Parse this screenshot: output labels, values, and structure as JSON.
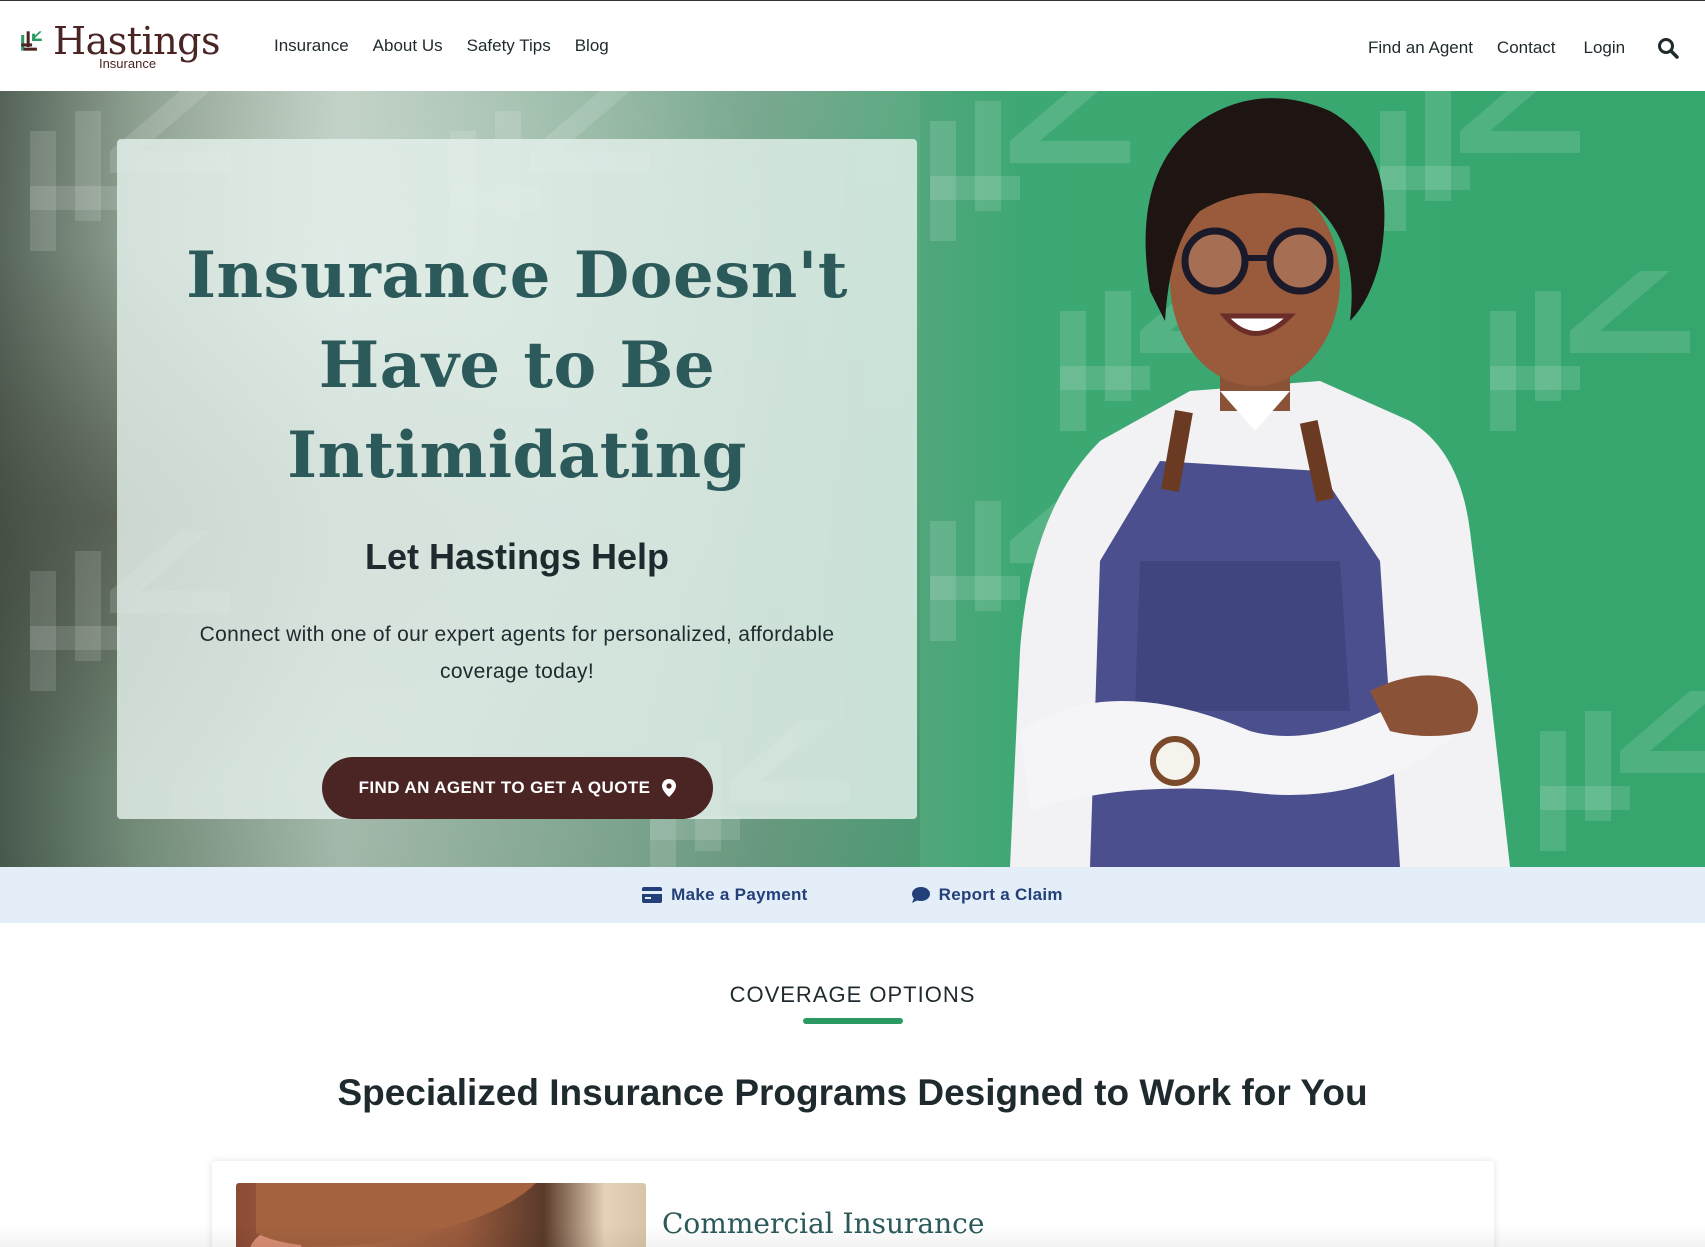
{
  "brand": {
    "name": "Hastings",
    "sub": "Insurance",
    "colors": {
      "maroon": "#4a2524",
      "green": "#2a9a62",
      "teal_text": "#2c5a5a",
      "link_blue": "#24407a"
    }
  },
  "nav": {
    "left": [
      "Insurance",
      "About Us",
      "Safety Tips",
      "Blog"
    ],
    "right": [
      "Find an Agent",
      "Contact",
      "Login"
    ],
    "search_icon": "search-icon"
  },
  "hero": {
    "title": "Insurance Doesn't Have to Be Intimidating",
    "subtitle": "Let Hastings Help",
    "body": "Connect with one of our expert agents for personalized, affordable coverage today!",
    "cta_label": "FIND AN AGENT TO GET A QUOTE",
    "cta_icon": "map-pin-icon"
  },
  "quick_links": {
    "payment": {
      "label": "Make a Payment",
      "icon": "credit-card-icon"
    },
    "claim": {
      "label": "Report a Claim",
      "icon": "chat-bubble-icon"
    }
  },
  "coverage": {
    "eyebrow": "COVERAGE OPTIONS",
    "title": "Specialized Insurance Programs Designed to Work for You",
    "cards": [
      {
        "title": "Commercial Insurance"
      }
    ]
  }
}
